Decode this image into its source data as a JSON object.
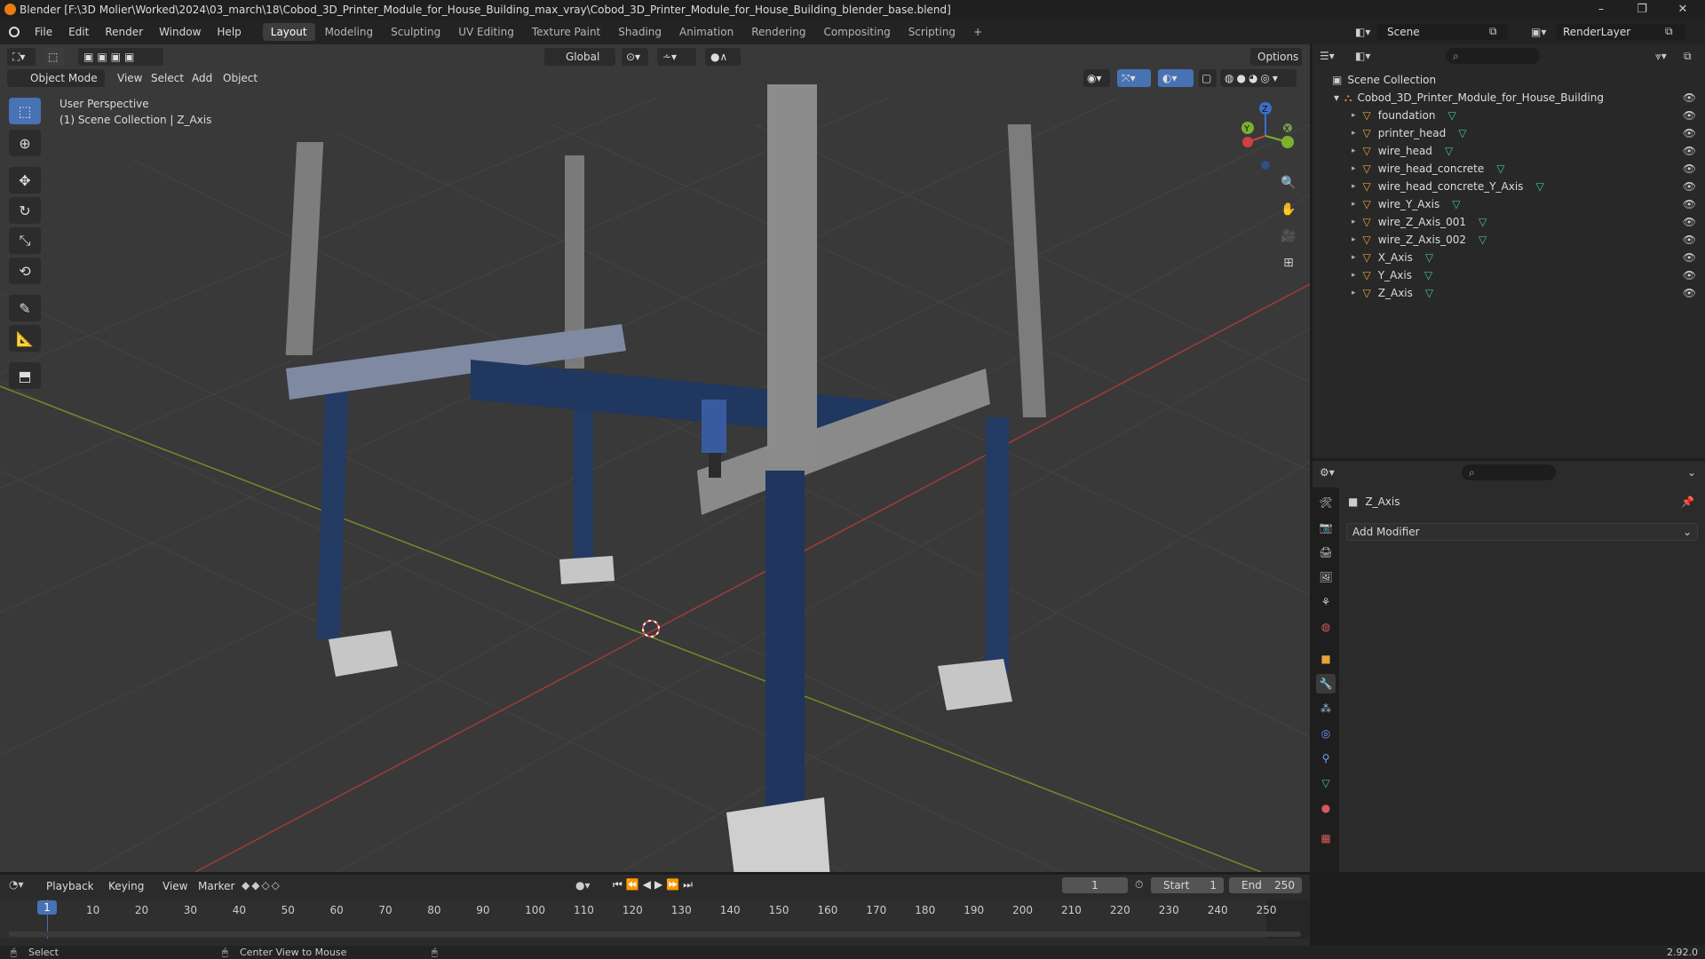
{
  "window": {
    "title": "Blender [F:\\3D Molier\\Worked\\2024\\03_march\\18\\Cobod_3D_Printer_Module_for_House_Building_max_vray\\Cobod_3D_Printer_Module_for_House_Building_blender_base.blend]",
    "controls": [
      "–",
      "❐",
      "✕"
    ]
  },
  "menubar": {
    "menus": [
      "File",
      "Edit",
      "Render",
      "Window",
      "Help"
    ],
    "workspaces": [
      "Layout",
      "Modeling",
      "Sculpting",
      "UV Editing",
      "Texture Paint",
      "Shading",
      "Animation",
      "Rendering",
      "Compositing",
      "Scripting"
    ],
    "active_workspace": "Layout",
    "add_tab": "+",
    "scene": "Scene",
    "render_layer": "RenderLayer"
  },
  "viewport_header": {
    "mode": "Object Mode",
    "menus": [
      "View",
      "Select",
      "Add",
      "Object"
    ],
    "transform_orientation": "Global",
    "options": "Options"
  },
  "viewport": {
    "perspective": "User Perspective",
    "collection_info": "(1) Scene Collection | Z_Axis",
    "gizmo": {
      "x": "X",
      "y": "Y",
      "z": "Z"
    }
  },
  "toolbar": [
    "select-box",
    "cursor",
    "move",
    "rotate",
    "scale",
    "transform",
    "annotate",
    "measure",
    "add-cube"
  ],
  "outliner": {
    "root": "Scene Collection",
    "collection": "Cobod_3D_Printer_Module_for_House_Building",
    "objects": [
      {
        "name": "foundation"
      },
      {
        "name": "printer_head"
      },
      {
        "name": "wire_head"
      },
      {
        "name": "wire_head_concrete"
      },
      {
        "name": "wire_head_concrete_Y_Axis"
      },
      {
        "name": "wire_Y_Axis"
      },
      {
        "name": "wire_Z_Axis_001"
      },
      {
        "name": "wire_Z_Axis_002"
      },
      {
        "name": "X_Axis"
      },
      {
        "name": "Y_Axis"
      },
      {
        "name": "Z_Axis"
      }
    ]
  },
  "properties": {
    "object_name": "Z_Axis",
    "add_modifier": "Add Modifier",
    "active_tab": "modifier"
  },
  "timeline": {
    "menus": [
      "Playback",
      "Keying",
      "View",
      "Marker"
    ],
    "current_frame": "1",
    "start_label": "Start",
    "start": "1",
    "end_label": "End",
    "end": "250",
    "ticks": [
      "10",
      "20",
      "30",
      "40",
      "50",
      "60",
      "70",
      "80",
      "90",
      "100",
      "110",
      "120",
      "130",
      "140",
      "150",
      "160",
      "170",
      "180",
      "190",
      "200",
      "210",
      "220",
      "230",
      "240",
      "250"
    ],
    "playhead": "1"
  },
  "statusbar": {
    "left": "Select",
    "middle": "Center View to Mouse",
    "version": "2.92.0"
  }
}
